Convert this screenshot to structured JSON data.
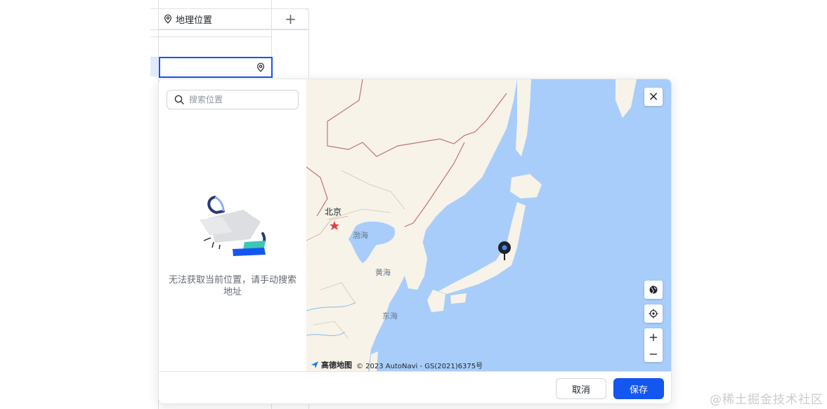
{
  "table": {
    "column_header": "地理位置",
    "add_column": "+"
  },
  "popup": {
    "search": {
      "placeholder": "搜索位置"
    },
    "empty_message": "无法获取当前位置，请手动搜索地址",
    "map": {
      "labels": {
        "beijing": "北京",
        "bohai": "渤海",
        "huanghai": "黄海",
        "donghai": "东海"
      },
      "brand": "高德地图",
      "copyright": "© 2023 AutoNavi - GS(2021)6375号",
      "zoom_in": "+",
      "zoom_out": "−",
      "close": "×"
    },
    "buttons": {
      "cancel": "取消",
      "save": "保存"
    },
    "colors": {
      "primary": "#1456f0",
      "sea": "#a8cdfa",
      "land": "#f7f3e8",
      "border": "#c2727a"
    }
  },
  "watermark": "@稀土掘金技术社区"
}
